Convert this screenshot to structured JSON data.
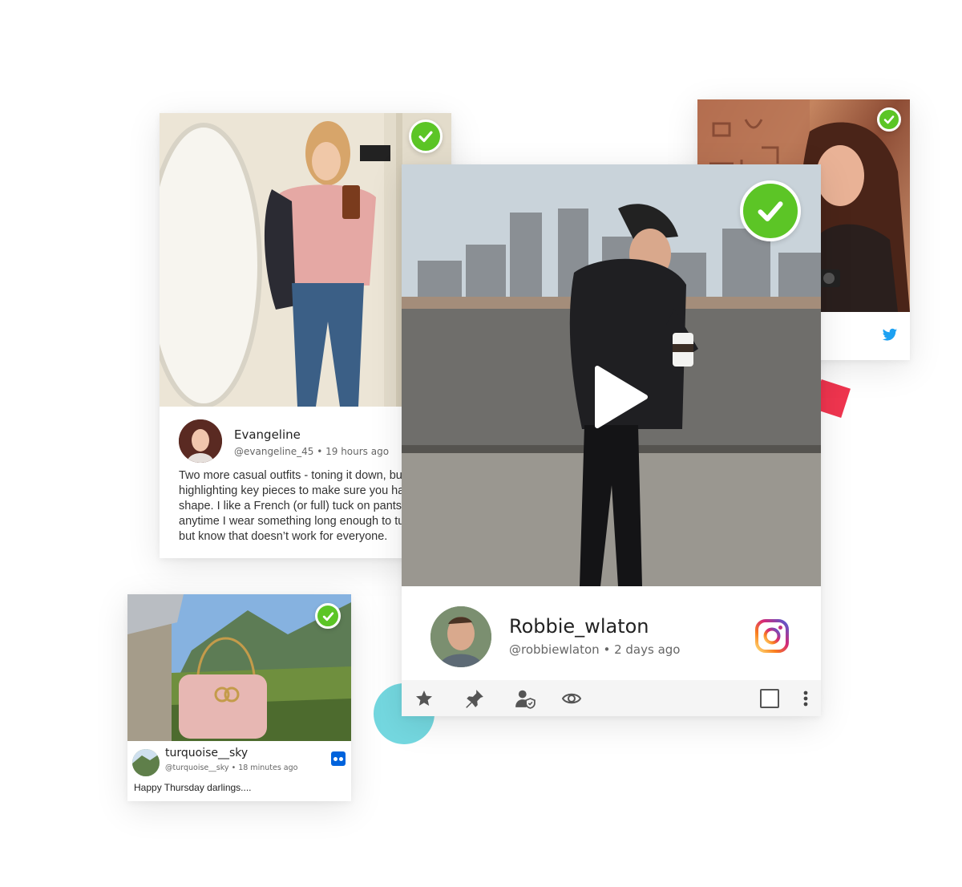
{
  "cards": {
    "evangeline": {
      "name": "Evangeline",
      "handle": "@evangeline_45",
      "time": "19 hours ago",
      "text": "Two more casual outfits - toning it down, but still highlighting key pieces to make sure you have shape. I like a French (or full) tuck on pants anytime I wear something long enough to tuck, but know that doesn’t work for everyone.",
      "check_icon": "check-circle-icon"
    },
    "twitter_post": {
      "network_icon": "twitter-bird-icon",
      "check_icon": "check-circle-icon"
    },
    "robbie": {
      "name": "Robbie_wlaton",
      "handle": "@robbiewlaton",
      "time": "2 days ago",
      "network_icon": "instagram-icon",
      "play_icon": "play-icon",
      "check_icon": "check-circle-icon",
      "actions": [
        {
          "icon": "star-icon"
        },
        {
          "icon": "pin-icon"
        },
        {
          "icon": "user-shield-icon"
        },
        {
          "icon": "eye-icon"
        },
        {
          "icon": "checkbox-icon"
        },
        {
          "icon": "more-vertical-icon"
        }
      ]
    },
    "turquoise": {
      "name": "turquoise__sky",
      "handle": "@turquoise__sky",
      "time": "18 minutes ago",
      "text": "Happy Thursday darlings....",
      "network_icon": "flickr-icon",
      "check_icon": "check-circle-icon"
    }
  },
  "separator": "•",
  "colors": {
    "check_green": "#5cc526",
    "accent_red": "#f0354f",
    "accent_teal": "#74d8e0",
    "twitter_blue": "#1da1f2",
    "flickr_blue": "#0063dc"
  }
}
